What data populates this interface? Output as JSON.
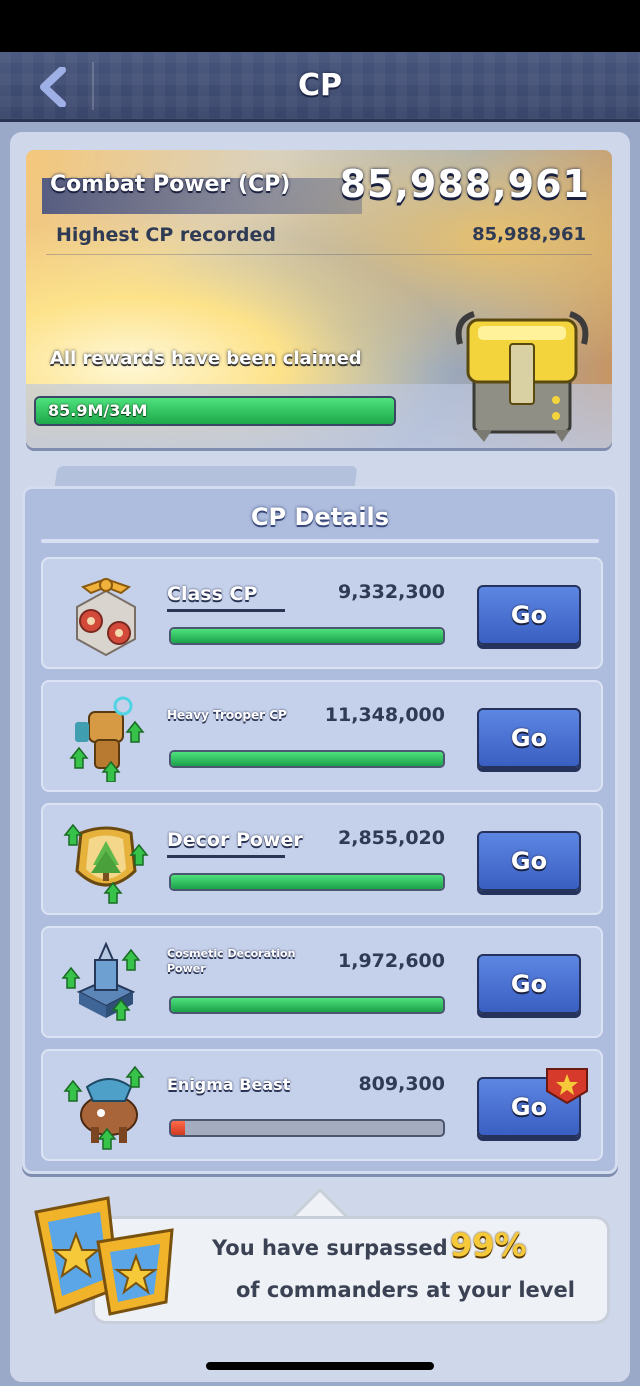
{
  "header": {
    "title": "CP",
    "back_icon": "chevron-left-icon"
  },
  "banner": {
    "title": "Combat Power (CP)",
    "total_cp": "85,988,961",
    "highest_label": "Highest CP recorded",
    "highest_value": "85,988,961",
    "rewards_status": "All rewards have been claimed",
    "progress_label": "85.9M/34M",
    "progress_fraction": 1.0,
    "chest_icon": "reward-chest-icon"
  },
  "details": {
    "title": "CP Details",
    "rows": [
      {
        "label": "Class CP",
        "value": "9,332,300",
        "progress": 1.0,
        "button": "Go",
        "icon": "class-emblem-icon"
      },
      {
        "label": "Heavy Trooper CP",
        "value": "11,348,000",
        "progress": 1.0,
        "button": "Go",
        "icon": "heavy-trooper-icon"
      },
      {
        "label": "Decor Power",
        "value": "2,855,020",
        "progress": 1.0,
        "button": "Go",
        "icon": "decor-badge-icon"
      },
      {
        "label": "Cosmetic Decoration Power",
        "value": "1,972,600",
        "progress": 1.0,
        "button": "Go",
        "icon": "cosmetic-tower-icon"
      },
      {
        "label": "Enigma Beast",
        "value": "809,300",
        "progress": 0.05,
        "button": "Go",
        "icon": "enigma-beast-icon",
        "badge_icon": "star-badge-icon"
      }
    ]
  },
  "surpass": {
    "line1": "You have surpassed",
    "percent": "99%",
    "line2": "of commanders at your level",
    "medal_icon": "star-medal-icon"
  },
  "colors": {
    "progress_green": "#2fc15d",
    "button_blue": "#4a72d4",
    "gold": "#f5c93a"
  }
}
